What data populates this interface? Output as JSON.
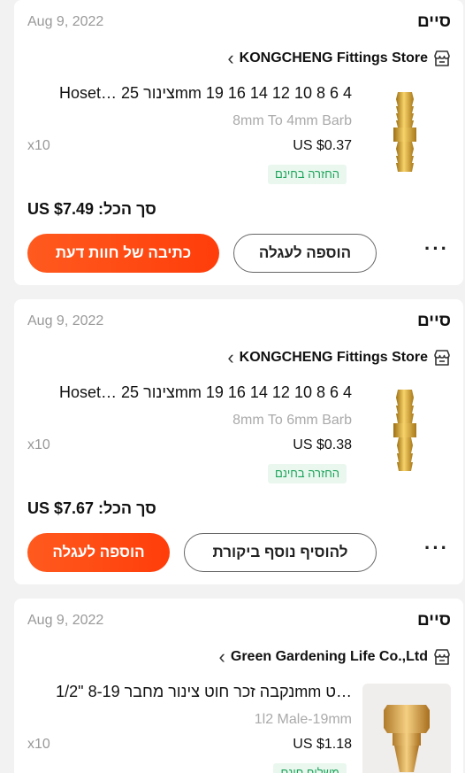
{
  "orders": [
    {
      "date": "Aug 9, 2022",
      "status": "סיים",
      "store_name": "KONGCHENG Fittings Store",
      "product_title": "Hoset… צינור 25mm 19 16 14 12 10 8 6 4",
      "variant": "8mm To 4mm Barb",
      "price": "US $0.37",
      "quantity": "x10",
      "badge": "החזרה בחינם",
      "total": "US $7.49 :סך הכל",
      "secondary_button": "הוספה לעגלה",
      "primary_button": "כתיבה של חוות דעת",
      "more": "···"
    },
    {
      "date": "Aug 9, 2022",
      "status": "סיים",
      "store_name": "KONGCHENG Fittings Store",
      "product_title": "Hoset… צינור 25mm 19 16 14 12 10 8 6 4",
      "variant": "8mm To 6mm Barb",
      "price": "US $0.38",
      "quantity": "x10",
      "badge": "החזרה בחינם",
      "total": "US $7.67 :סך הכל",
      "secondary_button": "להוסיף נוסף ביקורת",
      "primary_button": "הוספה לעגלה",
      "more": "···"
    },
    {
      "date": "Aug 9, 2022",
      "status": "סיים",
      "store_name": "Green Gardening Life Co.,Ltd",
      "product_title": "1/2\" נקבה זכר חוט צינור מחבר 8-19mm ט…",
      "variant": "1l2 Male-19mm",
      "price": "US $1.18",
      "quantity": "x10",
      "badge": "משלוח חינם"
    }
  ],
  "icons": {
    "store": "store-icon",
    "chevron": "chevron-left-icon",
    "more": "more-dots-icon"
  },
  "colors": {
    "accent": "#ff4a12",
    "badge_text": "#1ca35a",
    "badge_bg": "#e9f7ee",
    "background": "#f2f2f2"
  }
}
